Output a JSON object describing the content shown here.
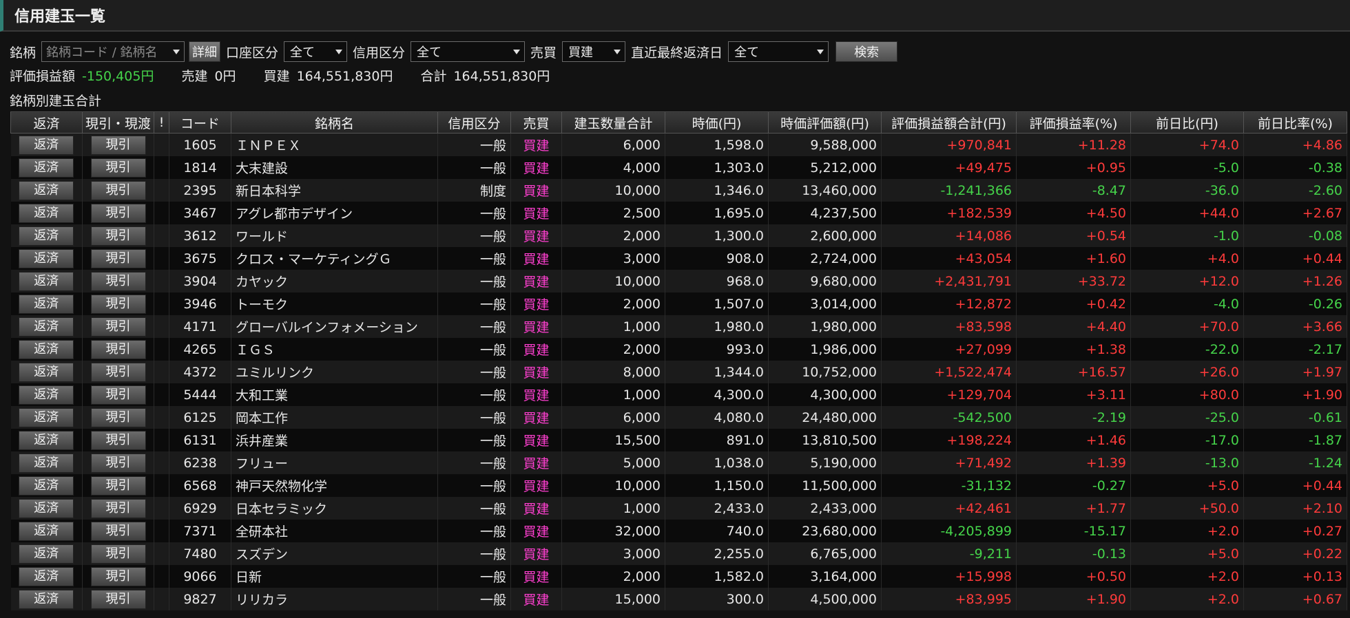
{
  "window": {
    "title": "信用建玉一覧"
  },
  "filters": {
    "brand_label": "銘柄",
    "brand_placeholder": "銘柄コード / 銘柄名",
    "detail_button": "詳細",
    "account_label": "口座区分",
    "account_value": "全て",
    "credit_label": "信用区分",
    "credit_value": "全て",
    "trade_label": "売買",
    "trade_value": "買建",
    "date_label": "直近最終返済日",
    "date_value": "全て",
    "search_button": "検索"
  },
  "summary": {
    "pl_label": "評価損益額",
    "pl_value": "-150,405円",
    "sell_label": "売建",
    "sell_value": "0円",
    "buy_label": "買建",
    "buy_value": "164,551,830円",
    "total_label": "合計",
    "total_value": "164,551,830円"
  },
  "section_title": "銘柄別建玉合計",
  "colors": {
    "up": "#ff3b3b",
    "down": "#45d44a",
    "buy": "#ff3fd0"
  },
  "table": {
    "columns": [
      "返済",
      "現引・現渡",
      "!",
      "コード",
      "銘柄名",
      "信用区分",
      "売買",
      "建玉数量合計",
      "時価(円)",
      "時価評価額(円)",
      "評価損益額合計(円)",
      "評価損益率(%)",
      "前日比(円)",
      "前日比率(%)"
    ],
    "repay_label": "返済",
    "genbiki_label": "現引",
    "rows": [
      {
        "code": "1605",
        "name": "ＩＮＰＥＸ",
        "kubun": "一般",
        "side": "買建",
        "qty": "6,000",
        "price": "1,598.0",
        "value": "9,588,000",
        "pl": "+970,841",
        "plr": "+11.28",
        "chg": "+74.0",
        "chgr": "+4.86"
      },
      {
        "code": "1814",
        "name": "大末建設",
        "kubun": "一般",
        "side": "買建",
        "qty": "4,000",
        "price": "1,303.0",
        "value": "5,212,000",
        "pl": "+49,475",
        "plr": "+0.95",
        "chg": "-5.0",
        "chgr": "-0.38"
      },
      {
        "code": "2395",
        "name": "新日本科学",
        "kubun": "制度",
        "side": "買建",
        "qty": "10,000",
        "price": "1,346.0",
        "value": "13,460,000",
        "pl": "-1,241,366",
        "plr": "-8.47",
        "chg": "-36.0",
        "chgr": "-2.60"
      },
      {
        "code": "3467",
        "name": "アグレ都市デザイン",
        "kubun": "一般",
        "side": "買建",
        "qty": "2,500",
        "price": "1,695.0",
        "value": "4,237,500",
        "pl": "+182,539",
        "plr": "+4.50",
        "chg": "+44.0",
        "chgr": "+2.67"
      },
      {
        "code": "3612",
        "name": "ワールド",
        "kubun": "一般",
        "side": "買建",
        "qty": "2,000",
        "price": "1,300.0",
        "value": "2,600,000",
        "pl": "+14,086",
        "plr": "+0.54",
        "chg": "-1.0",
        "chgr": "-0.08"
      },
      {
        "code": "3675",
        "name": "クロス・マーケティングＧ",
        "kubun": "一般",
        "side": "買建",
        "qty": "3,000",
        "price": "908.0",
        "value": "2,724,000",
        "pl": "+43,054",
        "plr": "+1.60",
        "chg": "+4.0",
        "chgr": "+0.44"
      },
      {
        "code": "3904",
        "name": "カヤック",
        "kubun": "一般",
        "side": "買建",
        "qty": "10,000",
        "price": "968.0",
        "value": "9,680,000",
        "pl": "+2,431,791",
        "plr": "+33.72",
        "chg": "+12.0",
        "chgr": "+1.26"
      },
      {
        "code": "3946",
        "name": "トーモク",
        "kubun": "一般",
        "side": "買建",
        "qty": "2,000",
        "price": "1,507.0",
        "value": "3,014,000",
        "pl": "+12,872",
        "plr": "+0.42",
        "chg": "-4.0",
        "chgr": "-0.26"
      },
      {
        "code": "4171",
        "name": "グローバルインフォメーション",
        "kubun": "一般",
        "side": "買建",
        "qty": "1,000",
        "price": "1,980.0",
        "value": "1,980,000",
        "pl": "+83,598",
        "plr": "+4.40",
        "chg": "+70.0",
        "chgr": "+3.66"
      },
      {
        "code": "4265",
        "name": "ＩＧＳ",
        "kubun": "一般",
        "side": "買建",
        "qty": "2,000",
        "price": "993.0",
        "value": "1,986,000",
        "pl": "+27,099",
        "plr": "+1.38",
        "chg": "-22.0",
        "chgr": "-2.17"
      },
      {
        "code": "4372",
        "name": "ユミルリンク",
        "kubun": "一般",
        "side": "買建",
        "qty": "8,000",
        "price": "1,344.0",
        "value": "10,752,000",
        "pl": "+1,522,474",
        "plr": "+16.57",
        "chg": "+26.0",
        "chgr": "+1.97"
      },
      {
        "code": "5444",
        "name": "大和工業",
        "kubun": "一般",
        "side": "買建",
        "qty": "1,000",
        "price": "4,300.0",
        "value": "4,300,000",
        "pl": "+129,704",
        "plr": "+3.11",
        "chg": "+80.0",
        "chgr": "+1.90"
      },
      {
        "code": "6125",
        "name": "岡本工作",
        "kubun": "一般",
        "side": "買建",
        "qty": "6,000",
        "price": "4,080.0",
        "value": "24,480,000",
        "pl": "-542,500",
        "plr": "-2.19",
        "chg": "-25.0",
        "chgr": "-0.61"
      },
      {
        "code": "6131",
        "name": "浜井産業",
        "kubun": "一般",
        "side": "買建",
        "qty": "15,500",
        "price": "891.0",
        "value": "13,810,500",
        "pl": "+198,224",
        "plr": "+1.46",
        "chg": "-17.0",
        "chgr": "-1.87"
      },
      {
        "code": "6238",
        "name": "フリュー",
        "kubun": "一般",
        "side": "買建",
        "qty": "5,000",
        "price": "1,038.0",
        "value": "5,190,000",
        "pl": "+71,492",
        "plr": "+1.39",
        "chg": "-13.0",
        "chgr": "-1.24"
      },
      {
        "code": "6568",
        "name": "神戸天然物化学",
        "kubun": "一般",
        "side": "買建",
        "qty": "10,000",
        "price": "1,150.0",
        "value": "11,500,000",
        "pl": "-31,132",
        "plr": "-0.27",
        "chg": "+5.0",
        "chgr": "+0.44"
      },
      {
        "code": "6929",
        "name": "日本セラミック",
        "kubun": "一般",
        "side": "買建",
        "qty": "1,000",
        "price": "2,433.0",
        "value": "2,433,000",
        "pl": "+42,461",
        "plr": "+1.77",
        "chg": "+50.0",
        "chgr": "+2.10"
      },
      {
        "code": "7371",
        "name": "全研本社",
        "kubun": "一般",
        "side": "買建",
        "qty": "32,000",
        "price": "740.0",
        "value": "23,680,000",
        "pl": "-4,205,899",
        "plr": "-15.17",
        "chg": "+2.0",
        "chgr": "+0.27"
      },
      {
        "code": "7480",
        "name": "スズデン",
        "kubun": "一般",
        "side": "買建",
        "qty": "3,000",
        "price": "2,255.0",
        "value": "6,765,000",
        "pl": "-9,211",
        "plr": "-0.13",
        "chg": "+5.0",
        "chgr": "+0.22"
      },
      {
        "code": "9066",
        "name": "日新",
        "kubun": "一般",
        "side": "買建",
        "qty": "2,000",
        "price": "1,582.0",
        "value": "3,164,000",
        "pl": "+15,998",
        "plr": "+0.50",
        "chg": "+2.0",
        "chgr": "+0.13"
      },
      {
        "code": "9827",
        "name": "リリカラ",
        "kubun": "一般",
        "side": "買建",
        "qty": "15,000",
        "price": "300.0",
        "value": "4,500,000",
        "pl": "+83,995",
        "plr": "+1.90",
        "chg": "+2.0",
        "chgr": "+0.67"
      }
    ]
  }
}
